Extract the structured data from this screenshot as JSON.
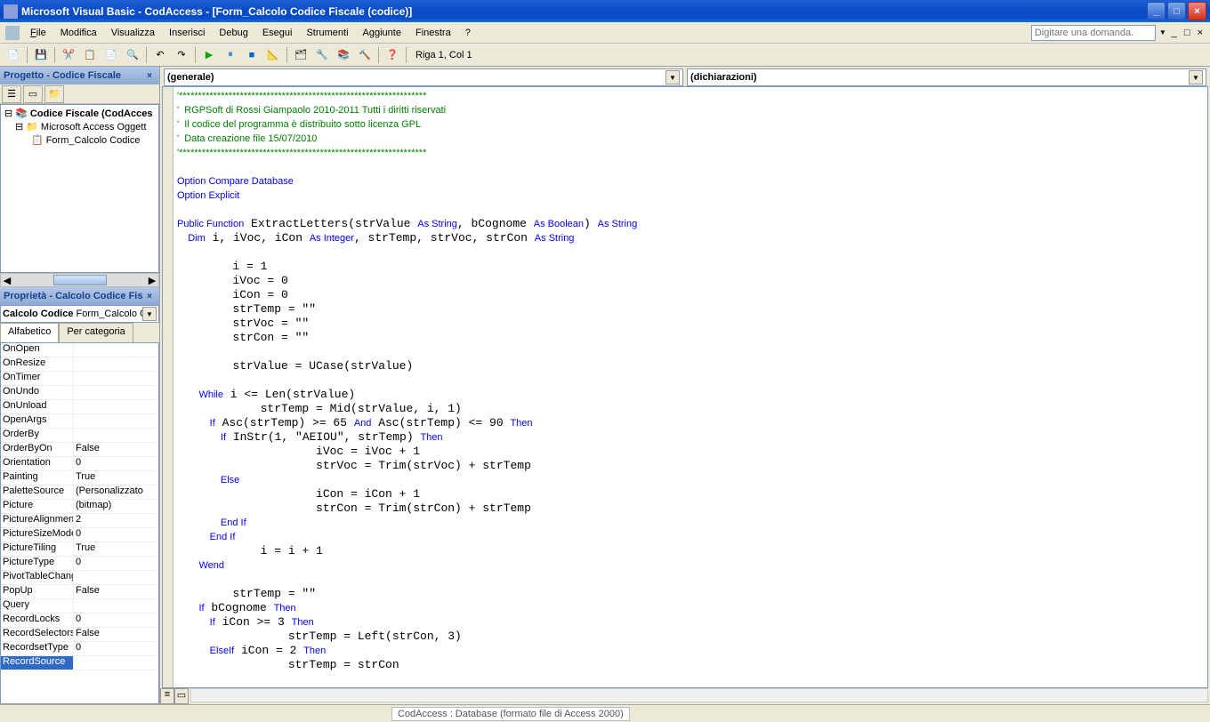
{
  "window": {
    "title": "Microsoft Visual Basic - CodAccess - [Form_Calcolo Codice Fiscale (codice)]"
  },
  "menubar": {
    "file": "File",
    "modifica": "Modifica",
    "visualizza": "Visualizza",
    "inserisci": "Inserisci",
    "debug": "Debug",
    "esegui": "Esegui",
    "strumenti": "Strumenti",
    "aggiunte": "Aggiunte",
    "finestra": "Finestra",
    "help": "?",
    "search_placeholder": "Digitare una domanda."
  },
  "toolbar": {
    "cursor": "Riga 1, Col 1"
  },
  "project": {
    "title": "Progetto - Codice Fiscale",
    "root": "Codice Fiscale (CodAcces",
    "folder": "Microsoft Access Oggett",
    "form": "Form_Calcolo Codice"
  },
  "properties": {
    "title": "Proprietà - Calcolo Codice Fis",
    "combo_label": "Calcolo Codice",
    "combo_value": "Form_Calcolo C",
    "tab_alpha": "Alfabetico",
    "tab_cat": "Per categoria",
    "rows": [
      {
        "name": "OnOpen",
        "val": ""
      },
      {
        "name": "OnResize",
        "val": ""
      },
      {
        "name": "OnTimer",
        "val": ""
      },
      {
        "name": "OnUndo",
        "val": ""
      },
      {
        "name": "OnUnload",
        "val": ""
      },
      {
        "name": "OpenArgs",
        "val": ""
      },
      {
        "name": "OrderBy",
        "val": ""
      },
      {
        "name": "OrderByOn",
        "val": "False"
      },
      {
        "name": "Orientation",
        "val": "0"
      },
      {
        "name": "Painting",
        "val": "True"
      },
      {
        "name": "PaletteSource",
        "val": "(Personalizzato"
      },
      {
        "name": "Picture",
        "val": "(bitmap)"
      },
      {
        "name": "PictureAlignmen",
        "val": "2"
      },
      {
        "name": "PictureSizeMode",
        "val": "0"
      },
      {
        "name": "PictureTiling",
        "val": "True"
      },
      {
        "name": "PictureType",
        "val": "0"
      },
      {
        "name": "PivotTableChang",
        "val": ""
      },
      {
        "name": "PopUp",
        "val": "False"
      },
      {
        "name": "Query",
        "val": ""
      },
      {
        "name": "RecordLocks",
        "val": "0"
      },
      {
        "name": "RecordSelectors",
        "val": "False"
      },
      {
        "name": "RecordsetType",
        "val": "0"
      },
      {
        "name": "RecordSource",
        "val": ""
      }
    ]
  },
  "editor": {
    "combo_left": "(generale)",
    "combo_right": "(dichiarazioni)"
  },
  "statusbar": {
    "file": "CodAccess : Database (formato file di Access 2000)"
  },
  "code": {
    "c1": "'*****************************************************************",
    "c2": "'  RGPSoft di Rossi Giampaolo 2010-2011 Tutti i diritti riservati",
    "c3": "'  Il codice del programma è distribuito sotto licenza GPL",
    "c4": "'  Data creazione file 15/07/2010",
    "c5": "'*****************************************************************",
    "l1a": "Option Compare Database",
    "l1b": "Option Explicit",
    "l2a": "Public Function",
    "l2b": " ExtractLetters(strValue ",
    "l2c": "As String",
    "l2d": ", bCognome ",
    "l2e": "As Boolean",
    "l2f": ") ",
    "l2g": "As String",
    "l3a": "    Dim",
    "l3b": " i, iVoc, iCon ",
    "l3c": "As Integer",
    "l3d": ", strTemp, strVoc, strCon ",
    "l3e": "As String",
    "l4": "        i = 1",
    "l5": "        iVoc = 0",
    "l6": "        iCon = 0",
    "l7": "        strTemp = \"\"",
    "l8": "        strVoc = \"\"",
    "l9": "        strCon = \"\"",
    "l10": "        strValue = UCase(strValue)",
    "l11a": "        While",
    "l11b": " i <= Len(strValue)",
    "l12": "            strTemp = Mid(strValue, i, 1)",
    "l13a": "            If",
    "l13b": " Asc(strTemp) >= 65 ",
    "l13c": "And",
    "l13d": " Asc(strTemp) <= 90 ",
    "l13e": "Then",
    "l14a": "                If",
    "l14b": " InStr(1, \"AEIOU\", strTemp) ",
    "l14c": "Then",
    "l15": "                    iVoc = iVoc + 1",
    "l16": "                    strVoc = Trim(strVoc) + strTemp",
    "l17": "                Else",
    "l18": "                    iCon = iCon + 1",
    "l19": "                    strCon = Trim(strCon) + strTemp",
    "l20": "                End If",
    "l21": "            End If",
    "l22": "            i = i + 1",
    "l23": "        Wend",
    "l24": "        strTemp = \"\"",
    "l25a": "        If",
    "l25b": " bCognome ",
    "l25c": "Then",
    "l26a": "            If",
    "l26b": " iCon >= 3 ",
    "l26c": "Then",
    "l27": "                strTemp = Left(strCon, 3)",
    "l28a": "            ElseIf",
    "l28b": " iCon = 2 ",
    "l28c": "Then",
    "l29": "                strTemp = strCon"
  }
}
